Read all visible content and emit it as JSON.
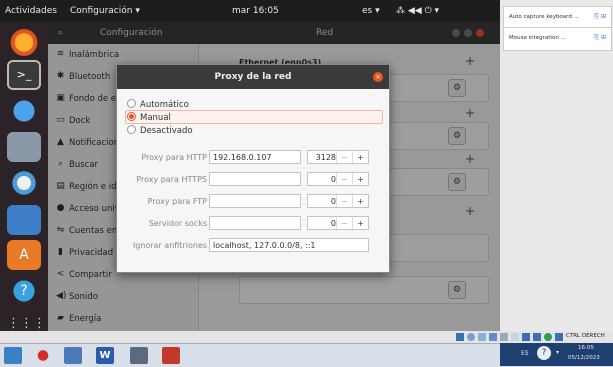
{
  "topbar": {
    "activities": "Actividades",
    "app_menu": "Configuración ▾",
    "clock": "mar 16:05",
    "lang": "es ▾",
    "indicators": "⁂ ◀◀ ⏻ ▾"
  },
  "settings": {
    "sidebar_title": "Configuración",
    "main_title": "Red",
    "items": [
      {
        "icon": "≋",
        "label": "Inalámbrica"
      },
      {
        "icon": "✱",
        "label": "Bluetooth"
      },
      {
        "icon": "▣",
        "label": "Fondo de es"
      },
      {
        "icon": "▭",
        "label": "Dock"
      },
      {
        "icon": "▲",
        "label": "Notificacione"
      },
      {
        "icon": "⌕",
        "label": "Buscar"
      },
      {
        "icon": "▤",
        "label": "Región e idio"
      },
      {
        "icon": "●",
        "label": "Acceso unive"
      },
      {
        "icon": "⇋",
        "label": "Cuentas en lí"
      },
      {
        "icon": "▮",
        "label": "Privacidad"
      },
      {
        "icon": "<",
        "label": "Compartir"
      },
      {
        "icon": "◀)",
        "label": "Sonido"
      },
      {
        "icon": "▰",
        "label": "Energía"
      }
    ],
    "ethernet_heading": "Ethernet (enp0s3)"
  },
  "dialog": {
    "title": "Proxy de la red",
    "modes": [
      {
        "label": "Automático",
        "selected": false
      },
      {
        "label": "Manual",
        "selected": true
      },
      {
        "label": "Desactivado",
        "selected": false
      }
    ],
    "rows": [
      {
        "label": "Proxy para HTTP",
        "value": "192.168.0.107",
        "port": "3128"
      },
      {
        "label": "Proxy para HTTPS",
        "value": "",
        "port": "0"
      },
      {
        "label": "Proxy para FTP",
        "value": "",
        "port": "0"
      },
      {
        "label": "Servidor socks",
        "value": "",
        "port": "0"
      }
    ],
    "ignore_label": "Ignorar anfitriones",
    "ignore_value": "localhost, 127.0.0.0/8, ::1",
    "minus": "−",
    "plus": "+"
  },
  "host_panel": {
    "rows": [
      {
        "label": "Auto capture keyboard ...",
        "icons": "⎘ ⊞"
      },
      {
        "label": "Mouse integration ...",
        "icons": "⎘ ⊞"
      }
    ]
  },
  "vbox_status": {
    "host_key": "CTRL DERECH"
  },
  "taskbar": {
    "lang": "ES",
    "time": "16:05",
    "date": "05/12/2023"
  },
  "colors": {
    "accent": "#e95420",
    "topbar": "#1d1d1d",
    "dock": "#2b2327",
    "taskbar": "#d8dfe9"
  }
}
